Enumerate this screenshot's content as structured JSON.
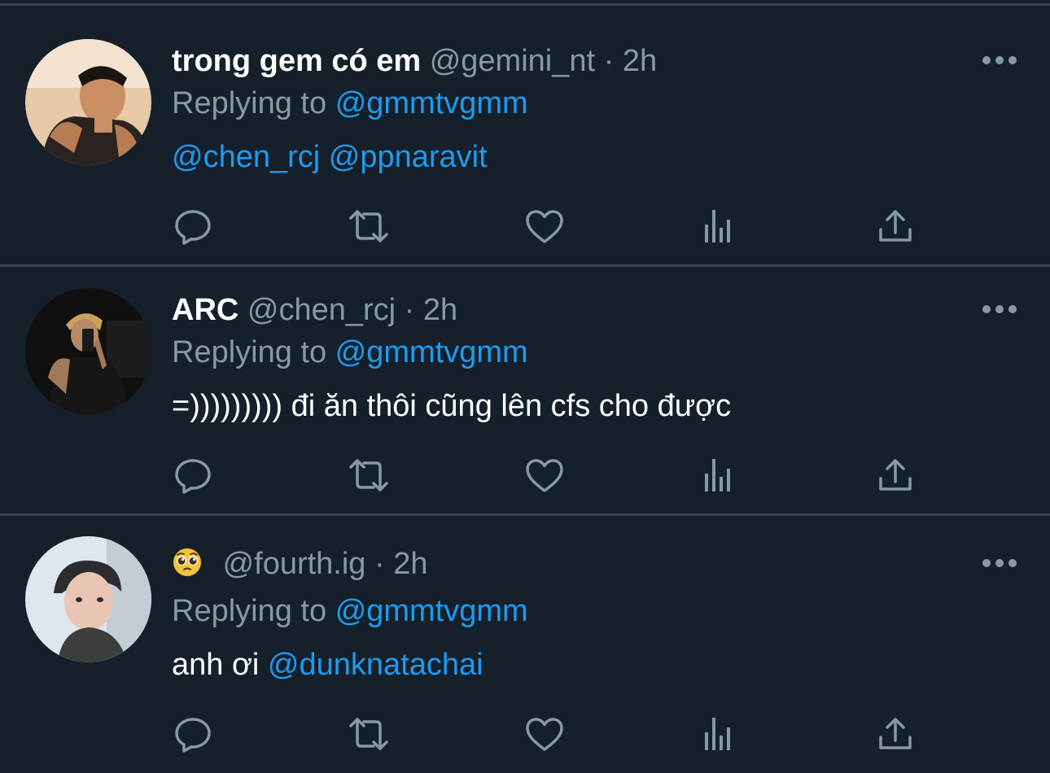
{
  "tweets": [
    {
      "name": "trong gem có em",
      "handle": "@gemini_nt",
      "separator": "·",
      "time": "2h",
      "replying_prefix": "Replying to",
      "replying_to": "@gmmtvgmm",
      "body_mentions": [
        "@chen_rcj",
        "@ppnaravit"
      ]
    },
    {
      "name": "ARC",
      "handle": "@chen_rcj",
      "separator": "·",
      "time": "2h",
      "replying_prefix": "Replying to",
      "replying_to": "@gmmtvgmm",
      "body_text": "=))))))))) đi ăn thôi cũng lên cfs cho được"
    },
    {
      "name_emoji": "pleading-face-emoji",
      "handle": "@fourth.ig",
      "separator": "·",
      "time": "2h",
      "replying_prefix": "Replying to",
      "replying_to": "@gmmtvgmm",
      "body_text": "anh ơi",
      "body_mention": "@dunknatachai"
    }
  ],
  "action_icons": [
    "reply-icon",
    "retweet-icon",
    "like-icon",
    "analytics-icon",
    "share-icon"
  ],
  "menu_icon": "more-icon",
  "colors": {
    "background": "#15202b",
    "divider": "#38444d",
    "text": "#ffffff",
    "secondary": "#8899a6",
    "accent": "#1d9bf0"
  }
}
